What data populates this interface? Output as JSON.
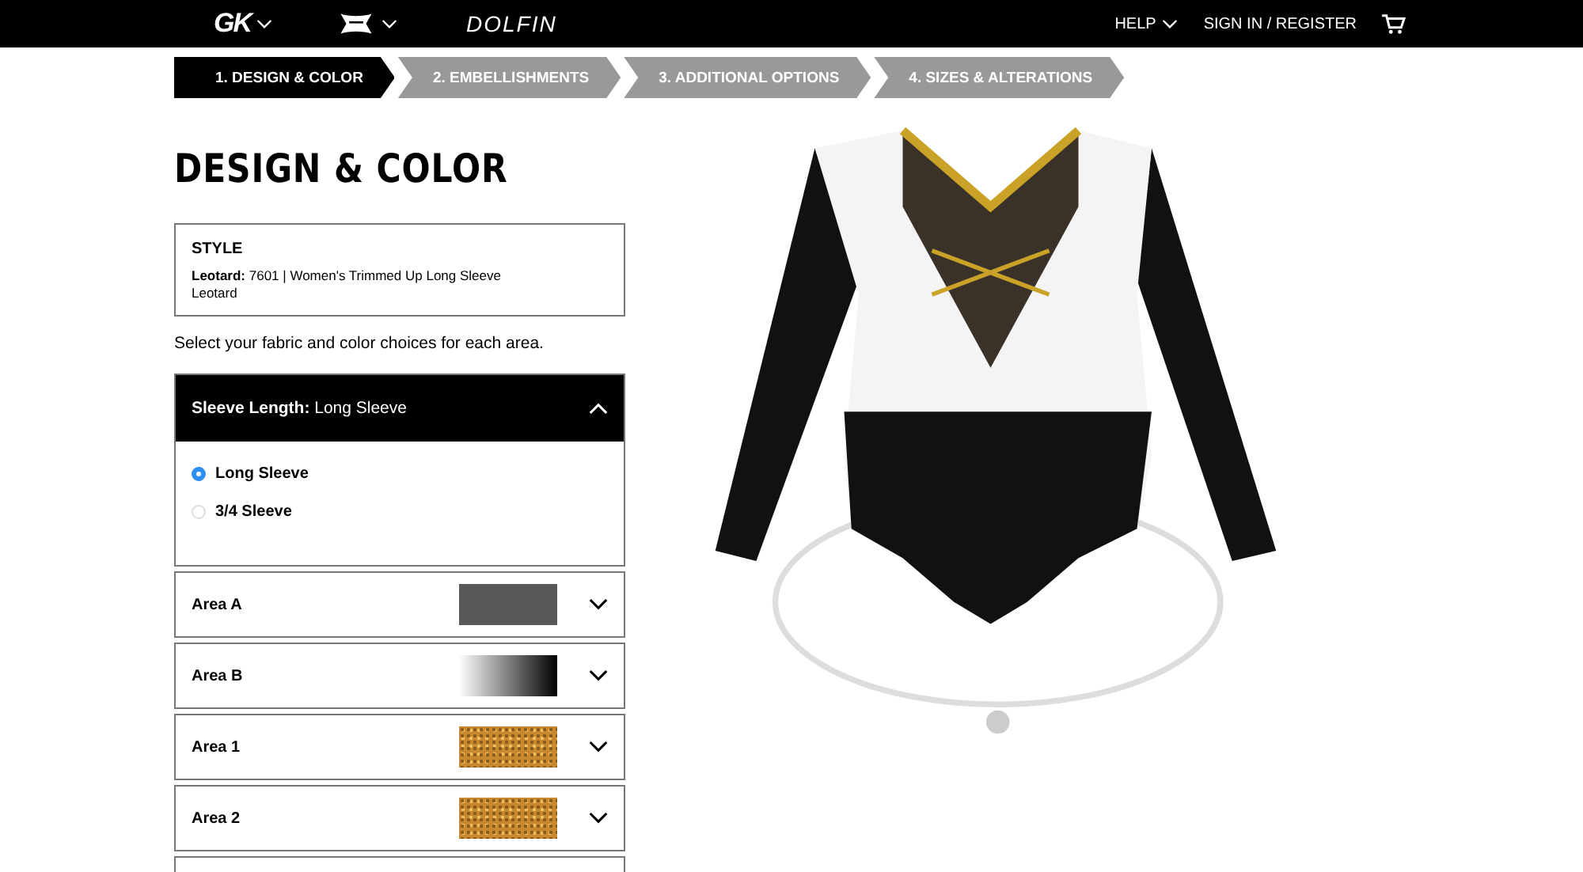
{
  "header": {
    "brands": [
      {
        "kind": "gk",
        "label": "GK"
      },
      {
        "kind": "ua"
      },
      {
        "kind": "dolfin",
        "label": "DOLFIN"
      }
    ],
    "help": "HELP",
    "sign_in": "SIGN IN / REGISTER"
  },
  "steps": [
    {
      "label": "1. DESIGN & COLOR",
      "selected": true
    },
    {
      "label": "2. EMBELLISHMENTS",
      "selected": false
    },
    {
      "label": "3. ADDITIONAL OPTIONS",
      "selected": false
    },
    {
      "label": "4. SIZES & ALTERATIONS",
      "selected": false
    }
  ],
  "title": "DESIGN & COLOR",
  "style_box": {
    "heading": "STYLE",
    "text": "**Leotard:** 7601 | Women's Trimmed Up Long Sleeve Leotard"
  },
  "instructions": "Select your fabric and color choices for each area.",
  "sleeve": {
    "label": "**Sleeve Length:** Long Sleeve",
    "expanded": true,
    "options": [
      {
        "label": "Long Sleeve",
        "selected": true
      },
      {
        "label": "3/4 Sleeve",
        "selected": false
      }
    ]
  },
  "areas": [
    {
      "label": "Area A",
      "kind": "solid",
      "color": "#58585a"
    },
    {
      "label": "Area B",
      "kind": "gradient"
    },
    {
      "label": "Area 1",
      "kind": "glitter",
      "color": "#c8892e"
    },
    {
      "label": "Area 2",
      "kind": "glitter",
      "color": "#c8892e"
    }
  ]
}
